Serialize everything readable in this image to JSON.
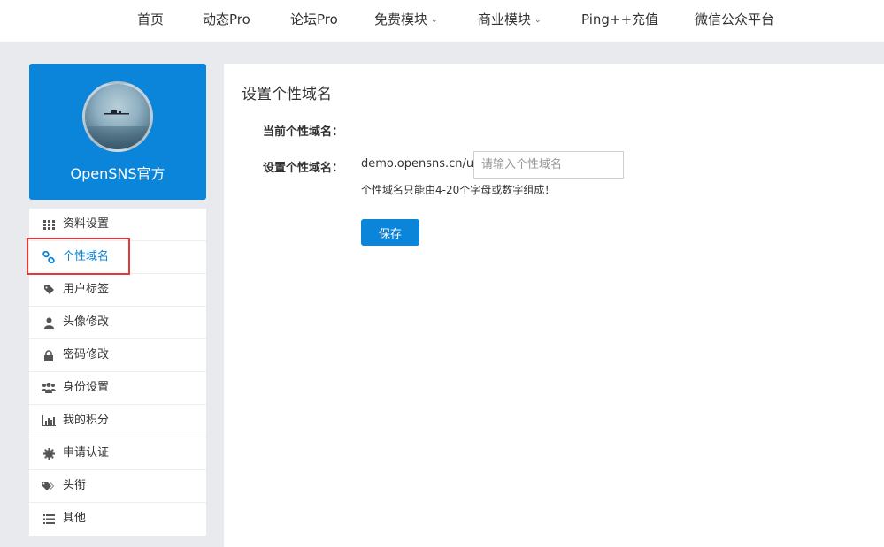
{
  "nav": {
    "items": [
      {
        "label": "首页"
      },
      {
        "label": "动态Pro"
      },
      {
        "label": "论坛Pro"
      },
      {
        "label": "免费模块",
        "dropdown": true
      },
      {
        "label": "商业模块",
        "dropdown": true
      },
      {
        "label": "Ping++充值"
      },
      {
        "label": "微信公众平台"
      }
    ]
  },
  "profile": {
    "name": "OpenSNS官方"
  },
  "sidebar": {
    "items": [
      {
        "label": "资料设置",
        "icon": "grid-icon"
      },
      {
        "label": "个性域名",
        "icon": "link-icon",
        "active": true
      },
      {
        "label": "用户标签",
        "icon": "tag-icon"
      },
      {
        "label": "头像修改",
        "icon": "user-icon"
      },
      {
        "label": "密码修改",
        "icon": "lock-icon"
      },
      {
        "label": "身份设置",
        "icon": "users-icon"
      },
      {
        "label": "我的积分",
        "icon": "bar-chart-icon"
      },
      {
        "label": "申请认证",
        "icon": "badge-icon"
      },
      {
        "label": "头衔",
        "icon": "tags-icon"
      },
      {
        "label": "其他",
        "icon": "list-icon"
      }
    ]
  },
  "main": {
    "title": "设置个性域名",
    "current_label": "当前个性域名：",
    "set_label": "设置个性域名：",
    "domain_prefix": "demo.opensns.cn/u/",
    "input_placeholder": "请输入个性域名",
    "input_value": "",
    "hint": "个性域名只能由4-20个字母或数字组成！",
    "save_label": "保存"
  },
  "colors": {
    "accent": "#0a85d9",
    "highlight": "#e53935",
    "background": "#e8eaed"
  }
}
